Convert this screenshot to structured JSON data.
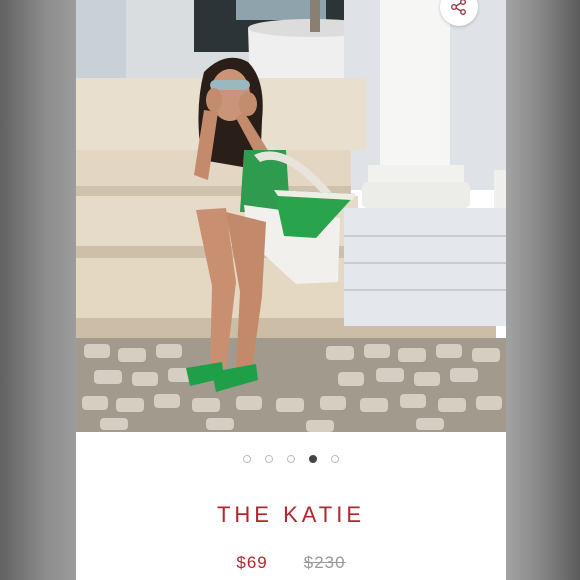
{
  "listing": {
    "title": "THE KATIE",
    "price": "$69",
    "original_price": "$230",
    "accent_color": "#b3262e"
  },
  "share": {
    "icon": "share-icon"
  },
  "carousel": {
    "total": 5,
    "active_index": 3
  }
}
